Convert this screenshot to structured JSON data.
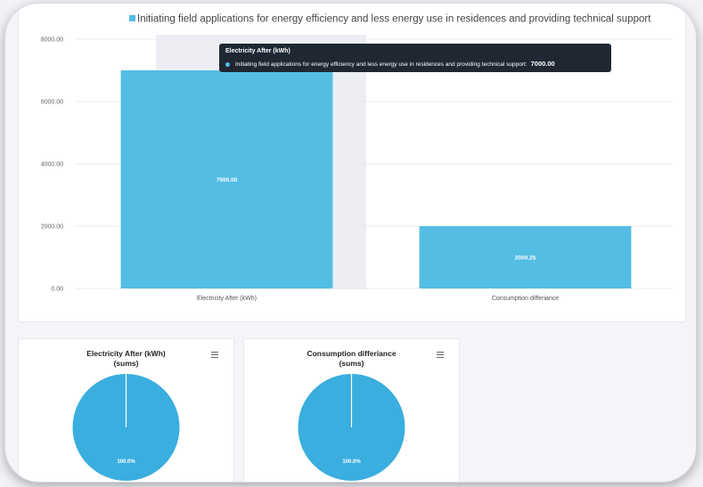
{
  "colors": {
    "bar": "#54bde4",
    "pie": "#3aaede",
    "hover_band": "#eceef4",
    "grid": "#e9ebef"
  },
  "chart_data": [
    {
      "type": "bar",
      "title": "",
      "legend": {
        "placement": "top",
        "entries": [
          "Initiating field applications for energy efficiency and less energy use in residences and providing technical support"
        ]
      },
      "categories": [
        "Electricity After (kWh)",
        "Consumption differiance"
      ],
      "series": [
        {
          "name": "Initiating field applications for energy efficiency and less energy use in residences and providing technical support",
          "values": [
            7000.0,
            2000.25
          ],
          "data_labels": [
            "7000.00",
            "2000.25"
          ]
        }
      ],
      "ylim": [
        0,
        8000
      ],
      "yticks": [
        0,
        2000,
        4000,
        6000,
        8000
      ],
      "ytick_labels": [
        "0.00",
        "2000.00",
        "4000.00",
        "6000.00",
        "8000.00"
      ],
      "grid": true,
      "tooltip": {
        "title": "Electricity After (kWh)",
        "series": "Initiating field applications for energy efficiency and less energy use in residences and providing technical support:",
        "value": "7000.00"
      }
    },
    {
      "type": "pie",
      "title": "Electricity After (kWh)",
      "subtitle": "(sums)",
      "slices": [
        {
          "value": 100,
          "label": "100.0%"
        }
      ]
    },
    {
      "type": "pie",
      "title": "Consumption differiance",
      "subtitle": "(sums)",
      "slices": [
        {
          "value": 100,
          "label": "100.0%"
        }
      ]
    }
  ]
}
